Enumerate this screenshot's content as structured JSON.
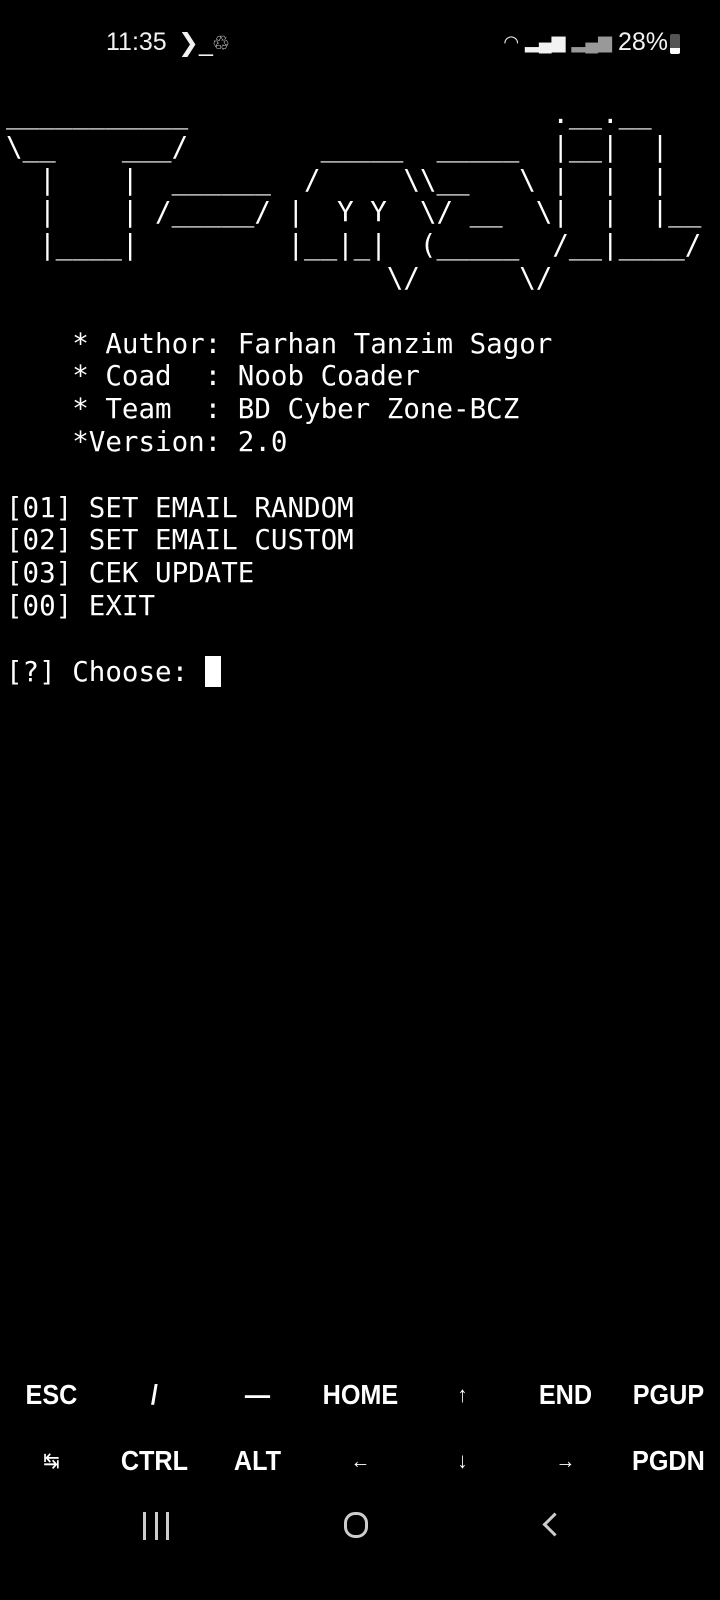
{
  "status_bar": {
    "time": "11:35",
    "battery": "28%",
    "icons": [
      "terminal-icon",
      "notification-app-icon",
      "wifi-icon",
      "signal-icon",
      "signal-icon",
      "battery-icon"
    ]
  },
  "terminal": {
    "banner": [
      "___________                      .__.__",
      "\\__    ___/        _____  _____  |__|  |",
      "  |    |  ______  /     \\\\__   \\ |  |  |",
      "  |    | /_____/ |  Y Y  \\/ __  \\|  |  |__",
      "  |____|         |__|_|  (_____  /__|____/",
      "                       \\/      \\/"
    ],
    "info": [
      "    * Author: Farhan Tanzim Sagor",
      "    * Coad  : Noob Coader",
      "    * Team  : BD Cyber Zone-BCZ",
      "    *Version: 2.0"
    ],
    "menu": [
      "[01] SET EMAIL RANDOM",
      "[02] SET EMAIL CUSTOM",
      "[03] CEK UPDATE",
      "[00] EXIT"
    ],
    "prompt": "[?] Choose: "
  },
  "extra_keys": {
    "row1": [
      "ESC",
      "/",
      "—",
      "HOME",
      "↑",
      "END",
      "PGUP"
    ],
    "row2": [
      "↹",
      "CTRL",
      "ALT",
      "←",
      "↓",
      "→",
      "PGDN"
    ]
  }
}
